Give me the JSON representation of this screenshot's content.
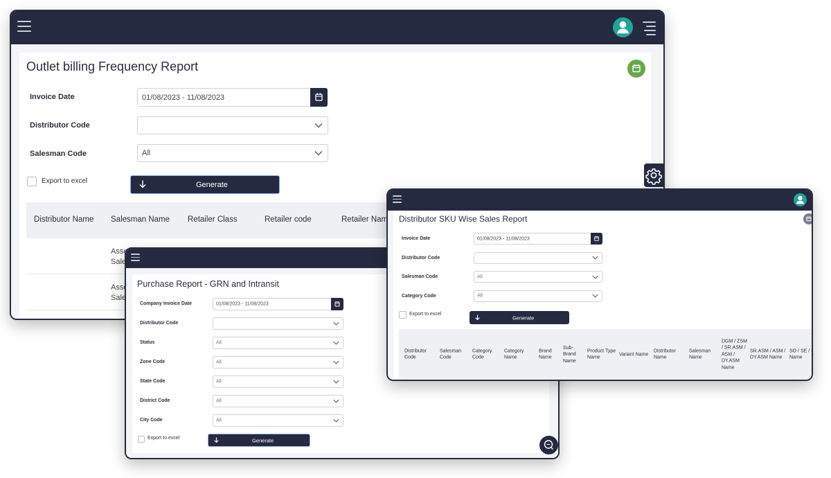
{
  "colors": {
    "nav": "#252a41",
    "accent_green": "#6aa64a",
    "avatar_teal": "#1fa596",
    "panel_bg": "#f3f4f7"
  },
  "outlet": {
    "title": "Outlet billing Frequency Report",
    "invoice_date_label": "Invoice Date",
    "invoice_date_value": "01/08/2023 - 11/08/2023",
    "distributor_code_label": "Distributor Code",
    "distributor_code_value": "",
    "salesman_code_label": "Salesman Code",
    "salesman_code_value": "All",
    "export_label": "Export to excel",
    "generate_label": "Generate",
    "columns": [
      "Distributor Name",
      "Salesman Name",
      "Retailer Class",
      "Retailer code",
      "Retailer Name"
    ],
    "row_fragments": [
      "Asset",
      "Sales",
      "Asse",
      "Sales"
    ]
  },
  "purchase": {
    "title": "Purchase Report - GRN and Intransit",
    "fields": [
      {
        "label": "Company Invoice Date",
        "value": "01/08/2023 - 11/08/2023",
        "kind": "date"
      },
      {
        "label": "Distributor Code",
        "value": "",
        "kind": "select"
      },
      {
        "label": "Status",
        "value": "All",
        "kind": "select"
      },
      {
        "label": "Zone Code",
        "value": "All",
        "kind": "select"
      },
      {
        "label": "State Code",
        "value": "All",
        "kind": "select"
      },
      {
        "label": "District Code",
        "value": "All",
        "kind": "select"
      },
      {
        "label": "City Code",
        "value": "All",
        "kind": "select"
      }
    ],
    "export_label": "Export to excel",
    "generate_label": "Generate"
  },
  "sku": {
    "title": "Distributor SKU Wise Sales Report",
    "fields": [
      {
        "label": "Invoice Date",
        "value": "01/08/2023 - 11/08/2023",
        "kind": "date"
      },
      {
        "label": "Distributor Code",
        "value": "",
        "kind": "select"
      },
      {
        "label": "Salesman Code",
        "value": "All",
        "kind": "select"
      },
      {
        "label": "Category Code",
        "value": "All",
        "kind": "select"
      }
    ],
    "export_label": "Export to excel",
    "generate_label": "Generate",
    "columns": [
      "Distributor Code",
      "Salesman Code",
      "Category Code",
      "Category Name",
      "Brand Name",
      "Sub-Brand Name",
      "Product Type Name",
      "Variant Name",
      "Distributor Name",
      "Salesman Name",
      "DGM / ZSM / SR.ASM / ASM / DY.ASM Name",
      "SR.ASM / ASM / DY.ASM Name",
      "SO / SE / S Name"
    ]
  },
  "icons": [
    "menu-icon",
    "user-avatar-icon",
    "right-menu-icon",
    "calendar-icon",
    "chevron-down-icon",
    "arrow-down-icon",
    "gear-icon",
    "chat-support-icon"
  ]
}
